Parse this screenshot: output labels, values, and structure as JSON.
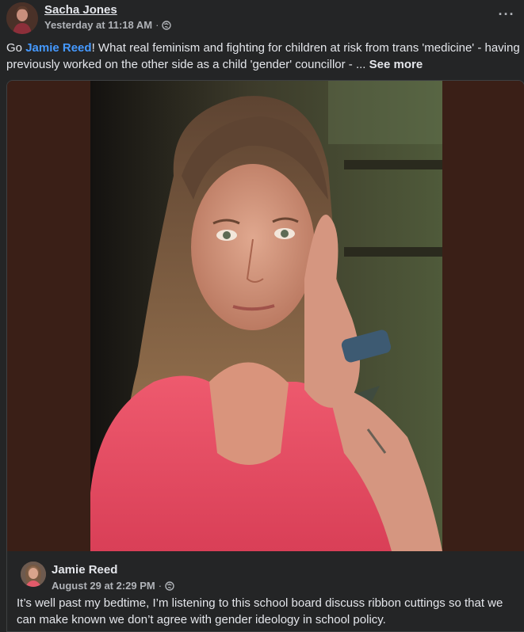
{
  "post": {
    "author": "Sacha Jones",
    "timestamp": "Yesterday at 11:18 AM",
    "separator": "·",
    "privacy_icon": "globe-icon",
    "more_icon": "more-options-icon",
    "more_label": "···",
    "text_before": "Go ",
    "mention": "Jamie Reed",
    "text_after": "! What real feminism and fighting for children at risk from trans 'medicine' - having previously worked on the other side as a child 'gender' councillor - ... ",
    "see_more": "See more"
  },
  "shared": {
    "author": "Jamie Reed",
    "timestamp": "August 29 at 2:29 PM",
    "separator": "·",
    "privacy_icon": "globe-icon",
    "text": "It’s well past my bedtime, I’m listening to this school board discuss ribbon cuttings so that we can make known we don’t agree with gender ideology in school policy."
  },
  "colors": {
    "background": "#242526",
    "text_primary": "#e4e6eb",
    "text_secondary": "#b0b3b8",
    "mention": "#4599ff",
    "photo_frame": "#3a1f17"
  }
}
